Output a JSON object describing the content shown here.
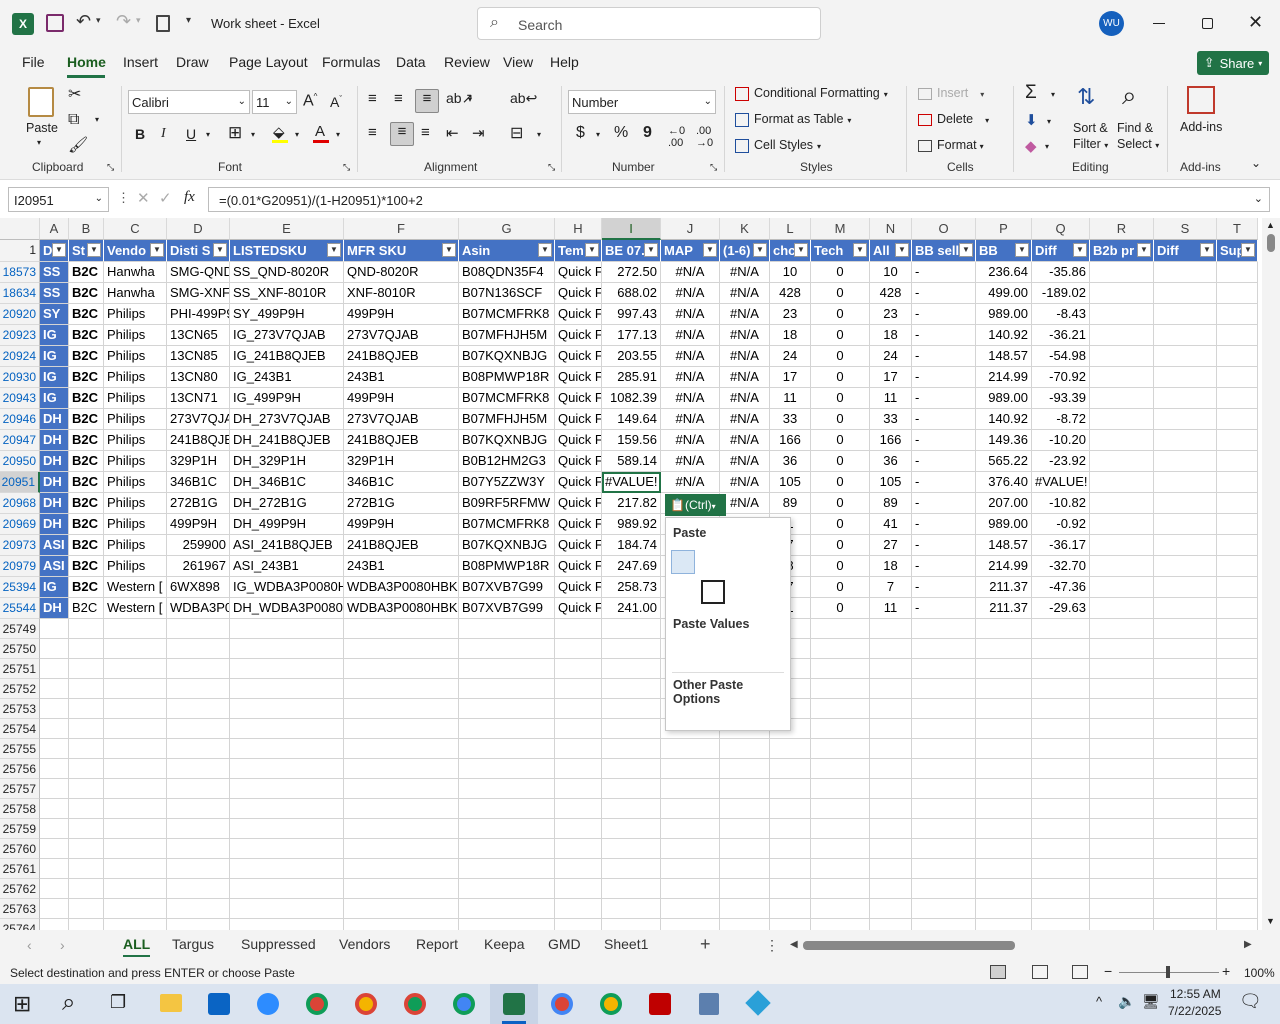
{
  "app": {
    "doc_title": "Work sheet",
    "app_name": "Excel",
    "sep": " - ",
    "search_placeholder": "Search",
    "avatar": "WU",
    "share": "Share"
  },
  "menu": [
    "File",
    "Home",
    "Insert",
    "Draw",
    "Page Layout",
    "Formulas",
    "Data",
    "Review",
    "View",
    "Help"
  ],
  "ribbon": {
    "clipboard": {
      "paste": "Paste",
      "label": "Clipboard"
    },
    "font": {
      "name": "Calibri",
      "size": "11",
      "label": "Font",
      "bold": "B",
      "italic": "I",
      "underline": "U"
    },
    "alignment": {
      "label": "Alignment"
    },
    "number": {
      "format": "Number",
      "currency": "$",
      "percent": "%",
      "comma": "9",
      "label": "Number"
    },
    "styles": {
      "cond": "Conditional Formatting",
      "table": "Format as Table",
      "cell": "Cell Styles",
      "label": "Styles"
    },
    "cells": {
      "insert": "Insert",
      "delete": "Delete",
      "format": "Format",
      "label": "Cells"
    },
    "editing": {
      "sort1": "Sort &",
      "sort2": "Filter",
      "find1": "Find &",
      "find2": "Select",
      "label": "Editing"
    },
    "addins": {
      "btn": "Add-ins",
      "label": "Add-ins"
    }
  },
  "formula_bar": {
    "name_box": "I20951",
    "fx": "fx",
    "formula": "=(0.01*G20951)/(1-H20951)*100+2"
  },
  "columns": [
    "A",
    "B",
    "C",
    "D",
    "E",
    "F",
    "G",
    "H",
    "I",
    "J",
    "K",
    "L",
    "M",
    "N",
    "O",
    "P",
    "Q",
    "R",
    "S",
    "T"
  ],
  "header_row": {
    "num": "1",
    "cells": [
      "D",
      "St",
      "Vendo",
      "Disti S",
      "LISTEDSKU",
      "MFR SKU",
      "Asin",
      "Tem",
      "BE 07.",
      "MAP",
      "(1-6)",
      "chc",
      "Tech",
      "All",
      "BB sell",
      "BB",
      "Diff",
      "B2b pr",
      "Diff",
      "Sup"
    ]
  },
  "rows": [
    {
      "n": "18573",
      "c": [
        "SS",
        "B2C",
        "Hanwha",
        "SMG-QND",
        "SS_QND-8020R",
        "QND-8020R",
        "B08QDN35F4",
        "Quick F",
        "272.50",
        "#N/A",
        "#N/A",
        "10",
        "0",
        "10",
        "-",
        "236.64",
        "-35.86",
        "",
        "",
        ""
      ]
    },
    {
      "n": "18634",
      "c": [
        "SS",
        "B2C",
        "Hanwha",
        "SMG-XNF",
        "SS_XNF-8010R",
        "XNF-8010R",
        "B07N136SCF",
        "Quick F",
        "688.02",
        "#N/A",
        "#N/A",
        "428",
        "0",
        "428",
        "-",
        "499.00",
        "-189.02",
        "",
        "",
        ""
      ]
    },
    {
      "n": "20920",
      "c": [
        "SY",
        "B2C",
        "Philips",
        "PHI-499P9",
        "SY_499P9H",
        "499P9H",
        "B07MCMFRK8",
        "Quick F",
        "997.43",
        "#N/A",
        "#N/A",
        "23",
        "0",
        "23",
        "-",
        "989.00",
        "-8.43",
        "",
        "",
        ""
      ]
    },
    {
      "n": "20923",
      "c": [
        "IG",
        "B2C",
        "Philips",
        "13CN65",
        "IG_273V7QJAB",
        "273V7QJAB",
        "B07MFHJH5M",
        "Quick F",
        "177.13",
        "#N/A",
        "#N/A",
        "18",
        "0",
        "18",
        "-",
        "140.92",
        "-36.21",
        "",
        "",
        ""
      ]
    },
    {
      "n": "20924",
      "c": [
        "IG",
        "B2C",
        "Philips",
        "13CN85",
        "IG_241B8QJEB",
        "241B8QJEB",
        "B07KQXNBJG",
        "Quick F",
        "203.55",
        "#N/A",
        "#N/A",
        "24",
        "0",
        "24",
        "-",
        "148.57",
        "-54.98",
        "",
        "",
        ""
      ]
    },
    {
      "n": "20930",
      "c": [
        "IG",
        "B2C",
        "Philips",
        "13CN80",
        "IG_243B1",
        "243B1",
        "B08PMWP18R",
        "Quick F",
        "285.91",
        "#N/A",
        "#N/A",
        "17",
        "0",
        "17",
        "-",
        "214.99",
        "-70.92",
        "",
        "",
        ""
      ]
    },
    {
      "n": "20943",
      "c": [
        "IG",
        "B2C",
        "Philips",
        "13CN71",
        "IG_499P9H",
        "499P9H",
        "B07MCMFRK8",
        "Quick F",
        "1082.39",
        "#N/A",
        "#N/A",
        "11",
        "0",
        "11",
        "-",
        "989.00",
        "-93.39",
        "",
        "",
        ""
      ]
    },
    {
      "n": "20946",
      "c": [
        "DH",
        "B2C",
        "Philips",
        "273V7QJA",
        "DH_273V7QJAB",
        "273V7QJAB",
        "B07MFHJH5M",
        "Quick F",
        "149.64",
        "#N/A",
        "#N/A",
        "33",
        "0",
        "33",
        "-",
        "140.92",
        "-8.72",
        "",
        "",
        ""
      ]
    },
    {
      "n": "20947",
      "c": [
        "DH",
        "B2C",
        "Philips",
        "241B8QJE",
        "DH_241B8QJEB",
        "241B8QJEB",
        "B07KQXNBJG",
        "Quick F",
        "159.56",
        "#N/A",
        "#N/A",
        "166",
        "0",
        "166",
        "-",
        "149.36",
        "-10.20",
        "",
        "",
        ""
      ]
    },
    {
      "n": "20950",
      "c": [
        "DH",
        "B2C",
        "Philips",
        "329P1H",
        "DH_329P1H",
        "329P1H",
        "B0B12HM2G3",
        "Quick F",
        "589.14",
        "#N/A",
        "#N/A",
        "36",
        "0",
        "36",
        "-",
        "565.22",
        "-23.92",
        "",
        "",
        ""
      ]
    },
    {
      "n": "20951",
      "c": [
        "DH",
        "B2C",
        "Philips",
        "346B1C",
        "DH_346B1C",
        "346B1C",
        "B07Y5ZZW3Y",
        "Quick F",
        "#VALUE!",
        "#N/A",
        "#N/A",
        "105",
        "0",
        "105",
        "-",
        "376.40",
        "#VALUE!",
        "",
        "",
        ""
      ]
    },
    {
      "n": "20968",
      "c": [
        "DH",
        "B2C",
        "Philips",
        "272B1G",
        "DH_272B1G",
        "272B1G",
        "B09RF5RFMW",
        "Quick F",
        "217.82",
        "",
        "#N/A",
        "89",
        "0",
        "89",
        "-",
        "207.00",
        "-10.82",
        "",
        "",
        ""
      ]
    },
    {
      "n": "20969",
      "c": [
        "DH",
        "B2C",
        "Philips",
        "499P9H",
        "DH_499P9H",
        "499P9H",
        "B07MCMFRK8",
        "Quick F",
        "989.92",
        "",
        "",
        "1",
        "0",
        "41",
        "-",
        "989.00",
        "-0.92",
        "",
        "",
        ""
      ]
    },
    {
      "n": "20973",
      "c": [
        "ASI",
        "B2C",
        "Philips",
        "259900",
        "ASI_241B8QJEB",
        "241B8QJEB",
        "B07KQXNBJG",
        "Quick F",
        "184.74",
        "",
        "",
        "7",
        "0",
        "27",
        "-",
        "148.57",
        "-36.17",
        "",
        "",
        ""
      ]
    },
    {
      "n": "20979",
      "c": [
        "ASI",
        "B2C",
        "Philips",
        "261967",
        "ASI_243B1",
        "243B1",
        "B08PMWP18R",
        "Quick F",
        "247.69",
        "",
        "",
        "8",
        "0",
        "18",
        "-",
        "214.99",
        "-32.70",
        "",
        "",
        ""
      ]
    },
    {
      "n": "25394",
      "c": [
        "IG",
        "B2C",
        "Western [",
        "6WX898",
        "IG_WDBA3P0080H",
        "WDBA3P0080HBK-",
        "B07XVB7G99",
        "Quick F",
        "258.73",
        "",
        "",
        "7",
        "0",
        "7",
        "-",
        "211.37",
        "-47.36",
        "",
        "",
        ""
      ]
    },
    {
      "n": "25544",
      "c": [
        "DH",
        "B2C",
        "Western [",
        "WDBA3P0",
        "DH_WDBA3P0080H",
        "WDBA3P0080HBK-",
        "B07XVB7G99",
        "Quick F",
        "241.00",
        "",
        "",
        "1",
        "0",
        "11",
        "-",
        "211.37",
        "-29.63",
        "",
        "",
        ""
      ]
    }
  ],
  "empty_rows": [
    "25749",
    "25750",
    "25751",
    "25752",
    "25753",
    "25754",
    "25755",
    "25756",
    "25757",
    "25758",
    "25759",
    "25760",
    "25761",
    "25762",
    "25763",
    "25764"
  ],
  "paste_menu": {
    "ctrl": "(Ctrl)",
    "paste": "Paste",
    "values": "Paste Values",
    "other": "Other Paste Options"
  },
  "sheets": [
    "ALL",
    "Targus",
    "Suppressed",
    "Vendors",
    "Report",
    "Keepa",
    "GMD",
    "Sheet1"
  ],
  "status": {
    "message": "Select destination and press ENTER or choose Paste",
    "zoom": "100%"
  },
  "taskbar": {
    "time": "12:55 AM",
    "date": "7/22/2025"
  },
  "colors": {
    "excel_green": "#217346",
    "header_blue": "#4472c4",
    "link_blue": "#0563c1"
  }
}
